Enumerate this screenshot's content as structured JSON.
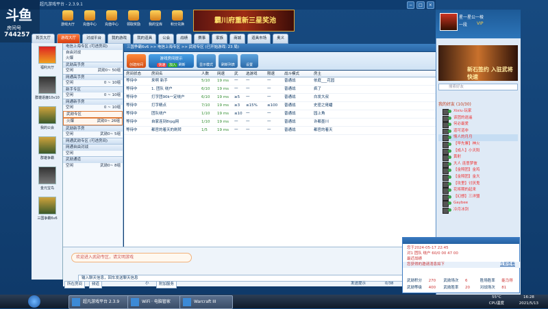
{
  "window": {
    "title": "超凡游戏平台 - 2.3.9.1"
  },
  "streamer": {
    "logo": "斗鱼",
    "label": "房间号",
    "room": "744257"
  },
  "top_icons": [
    "游戏大厅",
    "充值中心",
    "充值中心",
    "领取奖励",
    "我的宝库",
    "积分兑换"
  ],
  "banner_text": "霸川府重新三星奖池",
  "nav_tabs": [
    "首页大厅",
    "游戏大厅",
    "对战平台",
    "我的游戏",
    "我的道具",
    "公会",
    "战绩",
    "赛事",
    "家族",
    "商城",
    "道具市场",
    "奥义"
  ],
  "left_apps": [
    "福利大厅",
    "群雄逐鹿10v10",
    "我的公会",
    "群雄争霸",
    "金元宝鸟",
    "三国争霸6v6"
  ],
  "tree": [
    {
      "label": "电信上海专区 (可进房间)",
      "count": "",
      "hdr": true
    },
    {
      "label": "自由对战",
      "count": "",
      "hdr": false
    },
    {
      "label": "火爆",
      "count": "",
      "hdr": false
    },
    {
      "label": "武勋高手房",
      "count": "",
      "hdr": true
    },
    {
      "label": "空闲",
      "count": "武勋0~ 50组",
      "hdr": false
    },
    {
      "label": "网通高手房",
      "count": "",
      "hdr": true
    },
    {
      "label": "空闲",
      "count": "0 ~ 10组",
      "hdr": false
    },
    {
      "label": "新手专区",
      "count": "",
      "hdr": true
    },
    {
      "label": "空闲",
      "count": "0 ~ 10组",
      "hdr": false
    },
    {
      "label": "网通新手房",
      "count": "",
      "hdr": true
    },
    {
      "label": "空闲",
      "count": "0 ~ 10组",
      "hdr": false
    },
    {
      "label": "武勋专区",
      "count": "",
      "hdr": true,
      "sel": true
    },
    {
      "label": "火爆",
      "count": "武勋0~ 26组",
      "hdr": false,
      "sel": true
    },
    {
      "label": "武勋新手房",
      "count": "",
      "hdr": true
    },
    {
      "label": "空闲",
      "count": "武勋0~ 5组",
      "hdr": false
    },
    {
      "label": "网通武勋专区 (可进房间)",
      "count": "",
      "hdr": true
    },
    {
      "label": "网通自由对战",
      "count": "",
      "hdr": true
    },
    {
      "label": "空闲",
      "count": "",
      "hdr": false
    },
    {
      "label": "武勋通道",
      "count": "",
      "hdr": true
    },
    {
      "label": "空闲",
      "count": "武勋0~ 8组",
      "hdr": false
    }
  ],
  "breadcrumb": "三国争霸6v6 >> 电信上海专区 >> 武勋专区  (已开始游戏: 23 局)",
  "toolbar": {
    "create": "创建房间",
    "quick_join": "游戏房间提示",
    "quick_a": "快速",
    "quick_b": "加入",
    "refresh": "刷新",
    "mode": "显示模式",
    "search": "刷新列表",
    "settings": "设置"
  },
  "table": {
    "headers": [
      "房间状态",
      "房间名",
      "人数",
      "网速",
      "武",
      "选游戏",
      "限速",
      "战斗模式",
      "房主"
    ],
    "rows": [
      [
        "等待中",
        "来啊  新手",
        "5/10",
        "19 ms",
        "一",
        "一",
        "一",
        "普通战",
        "依庭___花园"
      ],
      [
        "等待中",
        "1. 团队  绕户",
        "6/10",
        "19 ms",
        "一",
        "一",
        "一",
        "普通战",
        "疯了"
      ],
      [
        "等待中",
        "打字团90k一定绕户",
        "6/10",
        "19 ms",
        "≥5",
        "一",
        "一",
        "普通战",
        "白发大叔"
      ],
      [
        "等待中",
        "打字精点",
        "7/10",
        "19 ms",
        "≥3",
        "≤15%",
        "≤100",
        "普通战",
        "史密之佬蟠"
      ],
      [
        "等待中",
        "团队绕户",
        "1/10",
        "19 ms",
        "≤10",
        "一",
        "一",
        "普通战",
        "园上角"
      ],
      [
        "等待中",
        "自家连到8rpg网",
        "1/10",
        "19 ms",
        "一",
        "一",
        "一",
        "普通战",
        "许都墨川"
      ],
      [
        "等待中",
        "都官的着天的刷转",
        "1/5",
        "19 ms",
        "一",
        "一",
        "一",
        "普通战",
        "都官的着天"
      ]
    ]
  },
  "chat": {
    "bubble": "欢迎进入武勋专区，请文明游戏",
    "input_placeholder": "输入聊天信息，回车发送聊天信息",
    "scope": "所在房间",
    "channel": "频道",
    "font": "小",
    "extra": "附加服务",
    "send_hint": "发送提示",
    "count": "0/38"
  },
  "profile": {
    "name": "星一星公一棱",
    "level": "一段",
    "vip": "VIP",
    "ad_text": "新石签约 入驻武将快速",
    "search_placeholder": "搜索好友"
  },
  "friends_header": "我的好友 (10/30)",
  "friends": [
    "Xixiu·玩家",
    "该团的逍遥",
    "何必最爱",
    "道可道非",
    "情人的月月",
    "【早先寨】神火",
    "【成人】小天阳",
    "黄射",
    "大人 连意梦彼",
    "【金翔团】金鸡",
    "【金翔团】金大",
    "【攻里】讨厌鬼",
    "花将期的起来",
    "【幻想】三洋盟",
    "Gaybee",
    "冷月冰剑"
  ],
  "popup": {
    "time": "您于2024-05-17  22:45",
    "line1": "对1  团队  绕户 60/0 00  47 00",
    "line2": "最近战绩",
    "invite": "您获得的邀请消息如下",
    "link": "立即查看",
    "stats": [
      [
        "武勋积分",
        "270",
        "武勋场次",
        "6",
        "胜场胜率",
        "能马得"
      ],
      [
        "武勋等级",
        "400",
        "武勋胜率",
        "20",
        "对战场次",
        "81"
      ]
    ]
  },
  "taskbar": {
    "items": [
      "超凡游戏平台 2.3.9",
      "WiFi · 电脑管家",
      "Warcraft III"
    ],
    "temp": "55°C",
    "cpu": "CPU温度",
    "time": "16:28",
    "date": "2021/5/13"
  },
  "colors": {
    "accent": "#1b4f86",
    "hot": "#d63e10",
    "selected": "#e07b39"
  }
}
